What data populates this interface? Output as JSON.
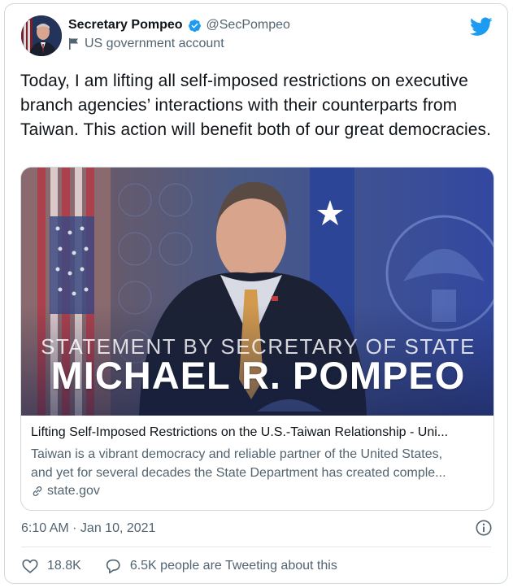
{
  "author": {
    "name": "Secretary Pompeo",
    "handle": "@SecPompeo",
    "label": "US government account",
    "verified": true,
    "avatar_icon": "avatar-portrait"
  },
  "brand": {
    "icon": "twitter-bird-icon",
    "color": "#1d9bf0"
  },
  "tweet": {
    "text": "Today, I am lifting all self-imposed restrictions on executive branch agencies’ interactions with their counterparts from Taiwan. This action will benefit both of our great democracies."
  },
  "link_card": {
    "image_line1": "STATEMENT BY SECRETARY OF STATE",
    "image_line2": "MICHAEL R. POMPEO",
    "title": "Lifting Self-Imposed Restrictions on the U.S.-Taiwan Relationship - Uni...",
    "description_line1": "Taiwan is a vibrant democracy and reliable partner of the United States,",
    "description_line2": "and yet for several decades the State Department has created comple...",
    "domain": "state.gov"
  },
  "meta": {
    "timestamp": "6:10 AM · Jan 10, 2021"
  },
  "actions": {
    "likes": "18.8K",
    "replies_text": "6.5K people are Tweeting about this"
  },
  "colors": {
    "text_primary": "#0f1419",
    "text_secondary": "#536471",
    "border": "#cfd9de",
    "verified_blue": "#1d9bf0"
  }
}
